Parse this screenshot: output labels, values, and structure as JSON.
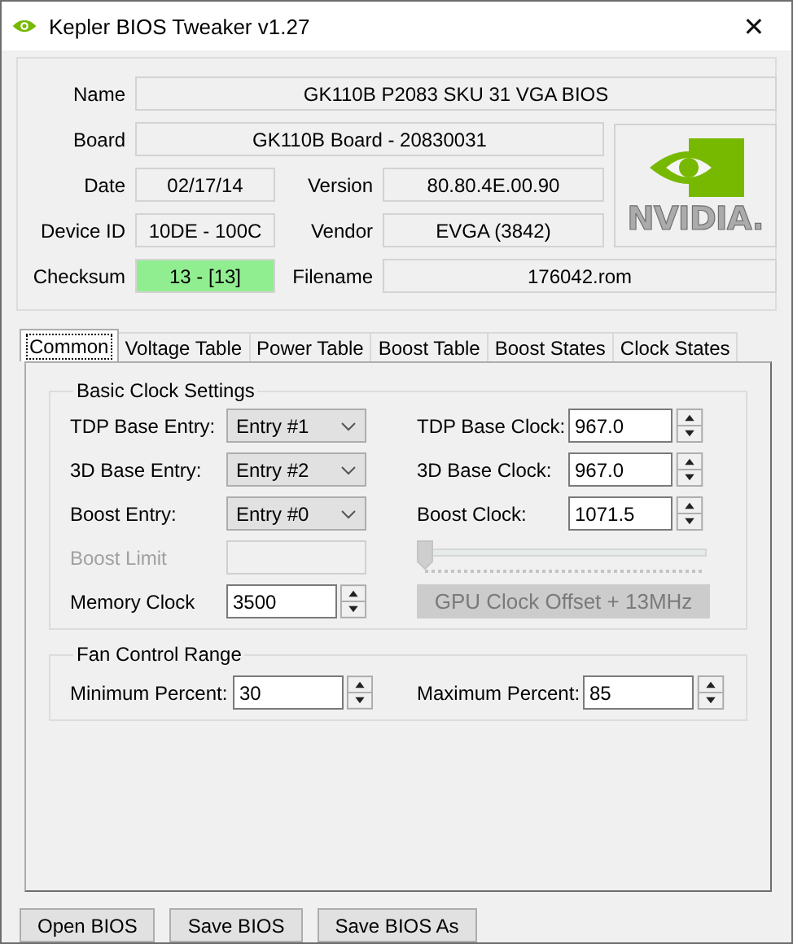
{
  "window": {
    "title": "Kepler BIOS Tweaker v1.27",
    "close": "✕"
  },
  "info": {
    "name": {
      "label": "Name",
      "value": "GK110B P2083 SKU 31 VGA BIOS"
    },
    "board": {
      "label": "Board",
      "value": "GK110B Board - 20830031"
    },
    "date": {
      "label": "Date",
      "value": "02/17/14"
    },
    "version": {
      "label": "Version",
      "value": "80.80.4E.00.90"
    },
    "device_id": {
      "label": "Device ID",
      "value": "10DE - 100C"
    },
    "vendor": {
      "label": "Vendor",
      "value": "EVGA (3842)"
    },
    "checksum": {
      "label": "Checksum",
      "value": "13 - [13]",
      "valid": true
    },
    "filename": {
      "label": "Filename",
      "value": "176042.rom"
    },
    "logo_text": "NVIDIA."
  },
  "tabs": [
    {
      "label": "Common",
      "selected": true
    },
    {
      "label": "Voltage Table",
      "selected": false
    },
    {
      "label": "Power Table",
      "selected": false
    },
    {
      "label": "Boost Table",
      "selected": false
    },
    {
      "label": "Boost States",
      "selected": false
    },
    {
      "label": "Clock States",
      "selected": false
    }
  ],
  "basic_clock": {
    "title": "Basic Clock Settings",
    "entries": [
      {
        "label": "TDP Base Entry:",
        "value": "Entry #1"
      },
      {
        "label": "3D Base Entry:",
        "value": "Entry #2"
      },
      {
        "label": "Boost Entry:",
        "value": "Entry #0"
      }
    ],
    "clocks": [
      {
        "label": "TDP Base Clock:",
        "value": "967.0"
      },
      {
        "label": "3D Base Clock:",
        "value": "967.0"
      },
      {
        "label": "Boost Clock:",
        "value": "1071.5"
      }
    ],
    "boost_limit": {
      "label": "Boost Limit",
      "disabled": true
    },
    "memory_clock": {
      "label": "Memory Clock",
      "value": "3500"
    },
    "slider": {
      "level": 0,
      "disabled": true
    },
    "offset_button": {
      "label": "GPU Clock Offset + 13MHz",
      "disabled": true
    }
  },
  "fan": {
    "title": "Fan Control Range",
    "min": {
      "label": "Minimum Percent:",
      "value": "30"
    },
    "max": {
      "label": "Maximum Percent:",
      "value": "85"
    }
  },
  "buttons": [
    "Open BIOS",
    "Save BIOS",
    "Save BIOS As"
  ]
}
